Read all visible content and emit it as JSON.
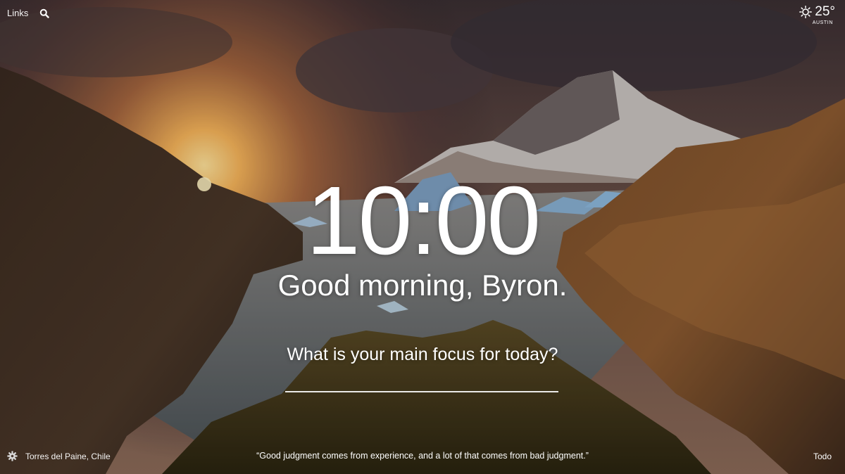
{
  "top": {
    "links_label": "Links",
    "search_icon": "search-icon"
  },
  "weather": {
    "icon": "sun-icon",
    "temperature": "25°",
    "city": "AUSTIN"
  },
  "main": {
    "clock": "10:00",
    "greeting": "Good morning, Byron.",
    "focus_question": "What is your main focus for today?",
    "focus_value": ""
  },
  "bottom": {
    "settings_icon": "gear-icon",
    "photo_location": "Torres del Paine, Chile",
    "quote": "“Good judgment comes from experience, and a lot of that comes from bad judgment.”",
    "todo_label": "Todo"
  },
  "colors": {
    "text": "#ffffff",
    "sky_glow": "#f3b45a",
    "rock": "#5a3f2c"
  }
}
